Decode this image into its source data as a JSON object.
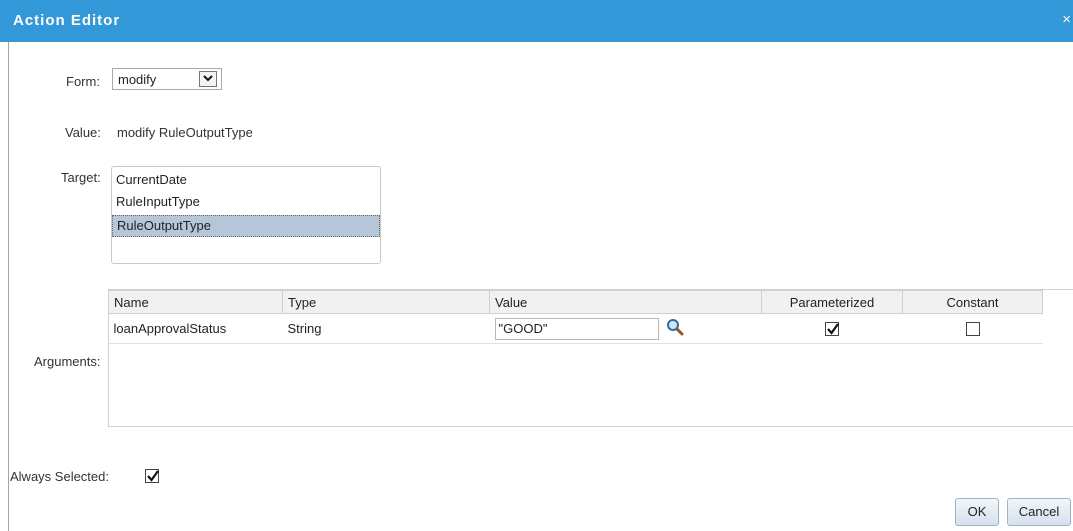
{
  "dialog": {
    "title": "Action Editor",
    "close_glyph": "×"
  },
  "form": {
    "label": "Form:",
    "selected": "modify",
    "arrow_icon": "chevron-down-icon"
  },
  "value": {
    "label": "Value:",
    "text": "modify RuleOutputType"
  },
  "target": {
    "label": "Target:",
    "items": [
      "CurrentDate",
      "RuleInputType",
      "RuleOutputType"
    ],
    "selected": "RuleOutputType"
  },
  "arguments": {
    "label": "Arguments:",
    "columns": [
      "Name",
      "Type",
      "Value",
      "Parameterized",
      "Constant"
    ],
    "rows": [
      {
        "name": "loanApprovalStatus",
        "type": "String",
        "value": "\"GOOD\"",
        "parameterized": true,
        "constant": false
      }
    ]
  },
  "always_selected": {
    "label": "Always Selected:",
    "checked": true
  },
  "buttons": {
    "ok": "OK",
    "cancel": "Cancel"
  },
  "colors": {
    "titlebar": "#3398d8",
    "selection": "#b5c6d8"
  }
}
